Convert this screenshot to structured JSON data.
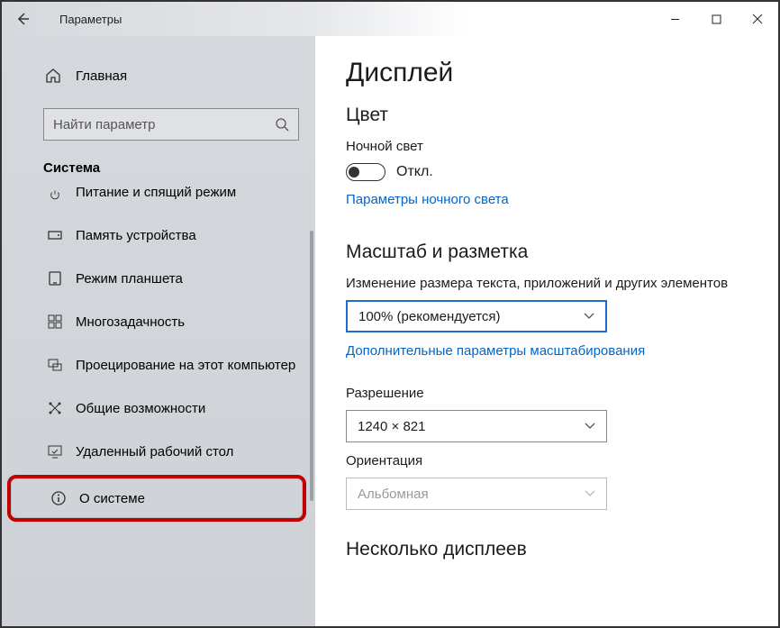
{
  "titlebar": {
    "title": "Параметры"
  },
  "sidebar": {
    "home": "Главная",
    "search_placeholder": "Найти параметр",
    "section": "Система",
    "items": [
      {
        "label": "Питание и спящий режим"
      },
      {
        "label": "Память устройства"
      },
      {
        "label": "Режим планшета"
      },
      {
        "label": "Многозадачность"
      },
      {
        "label": "Проецирование на этот компьютер"
      },
      {
        "label": "Общие возможности"
      },
      {
        "label": "Удаленный рабочий стол"
      },
      {
        "label": "О системе"
      }
    ]
  },
  "main": {
    "heading": "Дисплей",
    "color_heading": "Цвет",
    "night_light_label": "Ночной свет",
    "night_light_state": "Откл.",
    "night_light_link": "Параметры ночного света",
    "scale_heading": "Масштаб и разметка",
    "scale_label": "Изменение размера текста, приложений и других элементов",
    "scale_value": "100% (рекомендуется)",
    "scale_link": "Дополнительные параметры масштабирования",
    "resolution_label": "Разрешение",
    "resolution_value": "1240 × 821",
    "orientation_label": "Ориентация",
    "orientation_value": "Альбомная",
    "multi_heading": "Несколько дисплеев"
  }
}
